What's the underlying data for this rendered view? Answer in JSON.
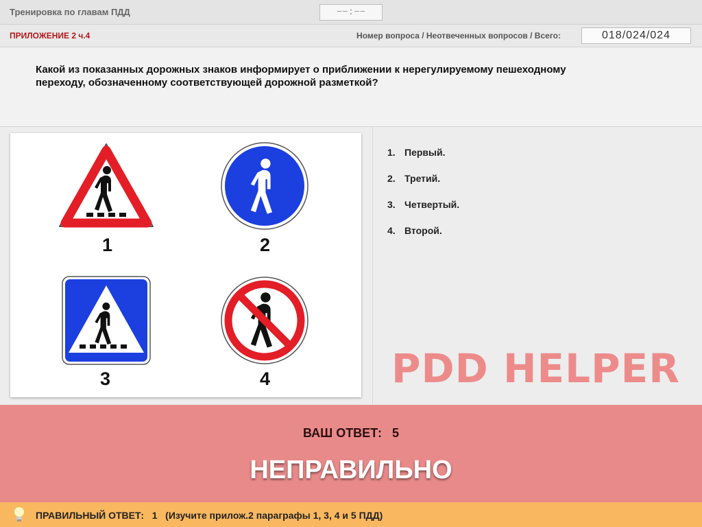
{
  "header": {
    "title": "Тренировка по главам ПДД",
    "timer": "−−:−−"
  },
  "info": {
    "section": "ПРИЛОЖЕНИЕ 2 ч.4",
    "counter_label": "Номер вопроса / Неотвеченных вопросов / Всего:",
    "counter_value": "018/024/024"
  },
  "question": {
    "text": "Какой из показанных дорожных знаков информирует о приближении к нерегулируемому пешеходному переходу, обозначенному соответствующей дорожной разметкой?"
  },
  "signs": [
    {
      "label": "1",
      "icon": "pedestrian-crossing-warning-triangle-icon"
    },
    {
      "label": "2",
      "icon": "pedestrian-path-blue-circle-icon"
    },
    {
      "label": "3",
      "icon": "pedestrian-crossing-blue-square-icon"
    },
    {
      "label": "4",
      "icon": "no-pedestrians-red-circle-icon"
    }
  ],
  "answers": [
    {
      "num": "1.",
      "text": "Первый."
    },
    {
      "num": "2.",
      "text": "Третий."
    },
    {
      "num": "3.",
      "text": "Четвертый."
    },
    {
      "num": "4.",
      "text": "Второй."
    }
  ],
  "watermark": "PDD HELPER",
  "result": {
    "your_answer_label": "ВАШ ОТВЕТ:",
    "your_answer_value": "5",
    "verdict": "НЕПРАВИЛЬНО"
  },
  "hint": {
    "label": "ПРАВИЛЬНЫЙ ОТВЕТ:",
    "value": "1",
    "note": "(Изучите прилож.2 параграфы 1, 3, 4 и 5 ПДД)"
  },
  "colors": {
    "section": "#b01818",
    "result_bg": "#e98a8a",
    "hint_bg": "#f9b760",
    "sign_red": "#e41e26",
    "sign_blue": "#1c3fe0"
  }
}
